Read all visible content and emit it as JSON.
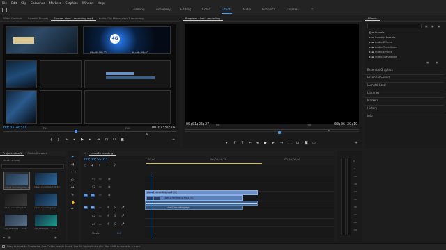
{
  "menu": [
    "File",
    "Edit",
    "Clip",
    "Sequence",
    "Markers",
    "Graphics",
    "Window",
    "Help"
  ],
  "workspaces": {
    "items": [
      "Learning",
      "Assembly",
      "Editing",
      "Color",
      "Effects",
      "Audio",
      "Graphics",
      "Libraries"
    ],
    "active": "Effects",
    "more": "»"
  },
  "source_panel": {
    "tabs": [
      "Effect Controls",
      "Lumetri Scopes",
      "Source: class1 recording.mp4",
      "Audio Clip Mixer: class1 recording"
    ],
    "active_tab": "Source: class1 recording.mp4",
    "thumb_tc_1": "00:06:06:22",
    "thumb_tc_2": "00:06:10:02",
    "thumb_tc_3": "00:06:06:22",
    "logo": "4G",
    "timecode": "00:03:40:11",
    "fit": "Fit",
    "zoom": "Full",
    "duration": "00:07:31:16"
  },
  "program_panel": {
    "title": "Program: class1 recording",
    "timecode": "00;01;25;27",
    "fit": "Fit",
    "zoom": "Full",
    "duration": "00;06;39;19"
  },
  "effects_panel": {
    "title": "Effects",
    "search_placeholder": "",
    "folders": [
      "Presets",
      "Lumetri Presets",
      "Audio Effects",
      "Audio Transitions",
      "Video Effects",
      "Video Transitions"
    ],
    "sections": [
      "Essential Graphics",
      "Essential Sound",
      "Lumetri Color",
      "Libraries",
      "Markers",
      "History",
      "Info"
    ]
  },
  "project_panel": {
    "tabs": [
      "Project: class1",
      "Media Browser"
    ],
    "file": "class1.prproj",
    "items": [
      {
        "name": "class1 recording",
        "dur": "7:31:16"
      },
      {
        "name": "class1 recording",
        "dur": "6:39:19"
      },
      {
        "name": "class1 recording",
        "dur": "0:43"
      },
      {
        "name": "class1 recording",
        "dur": "0:54"
      },
      {
        "name": "clip_001.mp4",
        "dur": "0:21"
      },
      {
        "name": "clip_001.mp4",
        "dur": "0:14"
      }
    ]
  },
  "timeline": {
    "tab": "class1 recording",
    "timecode": "00;00;55;03",
    "ruler": [
      "00;00",
      "00;04;59;29",
      "00;10;00;00"
    ],
    "video_tracks": [
      "V3",
      "V2",
      "V1"
    ],
    "audio_tracks": [
      "A1",
      "A2",
      "A3"
    ],
    "master": "Master",
    "master_value": "0.0",
    "clips": {
      "v2": "class1 recording.mp4 [V]",
      "v1": "class1 recording.mp4 [V]",
      "v1b": "class1 recording.mp4"
    }
  },
  "status_bar": "Drag to track to Overwrite. Use Ctrl to enable Insert. Use Alt to duplicate clip. Use Shift to move to a track.",
  "meter_db": [
    "0",
    "-6",
    "-12",
    "-18",
    "-24",
    "-30",
    "-36",
    "-42",
    "-48",
    "-54"
  ],
  "colors": {
    "accent": "#3e9fff",
    "video_clip": "#6a8ec8",
    "audio_clip": "#3d5f86",
    "playhead": "#3e9fff",
    "timeline_bar": "#d8c23a"
  }
}
